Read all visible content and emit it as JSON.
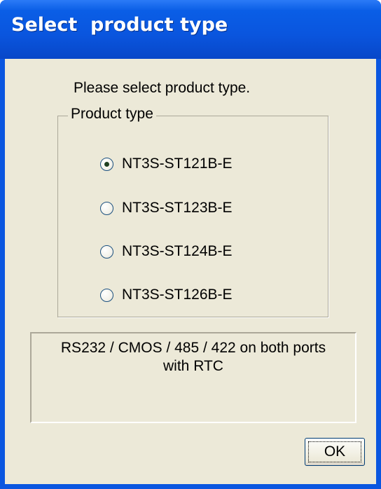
{
  "window": {
    "title": "Select  product type"
  },
  "dialog": {
    "prompt": "Please select product type.",
    "group_label": "Product type",
    "options": [
      {
        "label": "NT3S-ST121B-E",
        "checked": true
      },
      {
        "label": "NT3S-ST123B-E",
        "checked": false
      },
      {
        "label": "NT3S-ST124B-E",
        "checked": false
      },
      {
        "label": "NT3S-ST126B-E",
        "checked": false
      }
    ],
    "description_line1": "RS232 / CMOS / 485 / 422 on both ports",
    "description_line2": "with RTC",
    "ok_label": "OK"
  }
}
